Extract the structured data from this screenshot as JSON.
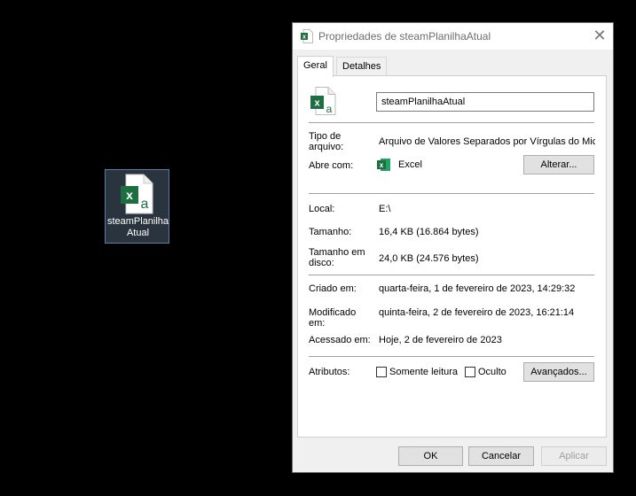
{
  "desktop": {
    "icon_label": "steamPlanilhaAtual",
    "icon_semantic": "excel-csv-file-icon"
  },
  "window": {
    "title": "Propriedades de steamPlanilhaAtual",
    "close_glyph": "✕"
  },
  "tabs": [
    {
      "label": "Geral",
      "active": true
    },
    {
      "label": "Detalhes",
      "active": false
    }
  ],
  "general": {
    "file_name": "steamPlanilhaAtual",
    "tipo_label": "Tipo de arquivo:",
    "tipo_value": "Arquivo de Valores Separados por Vírgulas do Microsoft Excel",
    "abre_label": "Abre com:",
    "abre_value": "Excel",
    "alterar_label": "Alterar...",
    "local_label": "Local:",
    "local_value": "E:\\",
    "tamanho_label": "Tamanho:",
    "tamanho_value": "16,4 KB (16.864 bytes)",
    "disco_label": "Tamanho em disco:",
    "disco_value": "24,0 KB (24.576 bytes)",
    "criado_label": "Criado em:",
    "criado_value": "quarta-feira, 1 de fevereiro de 2023, 14:29:32",
    "modificado_label": "Modificado em:",
    "modificado_value": "quinta-feira, 2 de fevereiro de 2023, 16:21:14",
    "acessado_label": "Acessado em:",
    "acessado_value": "Hoje, 2 de fevereiro de 2023",
    "atributos_label": "Atributos:",
    "somente_leitura_label": "Somente leitura",
    "oculto_label": "Oculto",
    "avancados_label": "Avançados..."
  },
  "footer": {
    "ok_label": "OK",
    "cancel_label": "Cancelar",
    "apply_label": "Aplicar"
  },
  "colors": {
    "excel_green": "#1d6f42",
    "desktop_bg": "#000000",
    "dialog_bg": "#f0f0f0"
  }
}
